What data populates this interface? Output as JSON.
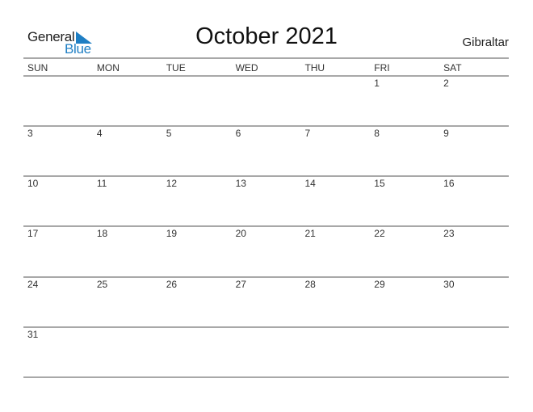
{
  "header": {
    "logo": {
      "line1": "General",
      "line2": "Blue",
      "accent_color": "#1f7fc4"
    },
    "title": "October 2021",
    "region": "Gibraltar"
  },
  "weekdays": [
    "SUN",
    "MON",
    "TUE",
    "WED",
    "THU",
    "FRI",
    "SAT"
  ],
  "weeks": [
    [
      "",
      "",
      "",
      "",
      "",
      "1",
      "2"
    ],
    [
      "3",
      "4",
      "5",
      "6",
      "7",
      "8",
      "9"
    ],
    [
      "10",
      "11",
      "12",
      "13",
      "14",
      "15",
      "16"
    ],
    [
      "17",
      "18",
      "19",
      "20",
      "21",
      "22",
      "23"
    ],
    [
      "24",
      "25",
      "26",
      "27",
      "28",
      "29",
      "30"
    ],
    [
      "31",
      "",
      "",
      "",
      "",
      "",
      ""
    ]
  ]
}
